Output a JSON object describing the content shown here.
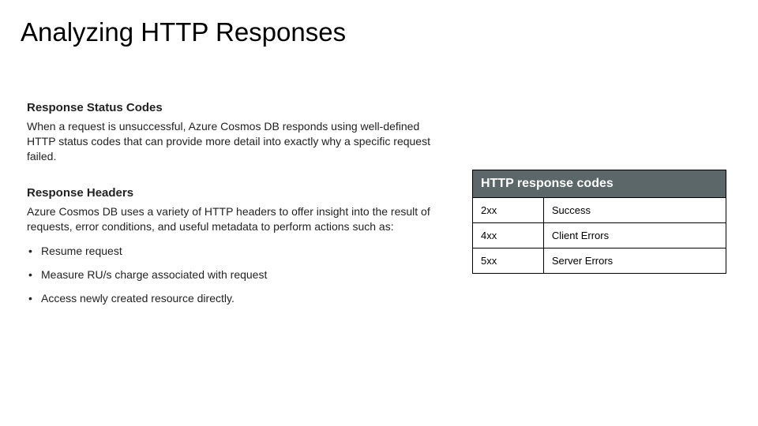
{
  "slide": {
    "title": "Analyzing HTTP Responses",
    "section1": {
      "heading": "Response Status Codes",
      "body": "When a request is unsuccessful, Azure Cosmos DB responds using well-defined HTTP status codes that can provide more detail into exactly why a specific request failed."
    },
    "section2": {
      "heading": "Response Headers",
      "body": "Azure Cosmos DB uses a variety of HTTP headers to offer insight into the result of requests, error conditions, and useful metadata to perform actions such as:",
      "bullets": [
        "Resume request",
        "Measure RU/s charge associated with request",
        "Access newly created resource directly."
      ]
    },
    "table": {
      "header": "HTTP response codes",
      "rows": [
        {
          "code": "2xx",
          "meaning": "Success"
        },
        {
          "code": "4xx",
          "meaning": "Client Errors"
        },
        {
          "code": "5xx",
          "meaning": "Server Errors"
        }
      ]
    }
  }
}
